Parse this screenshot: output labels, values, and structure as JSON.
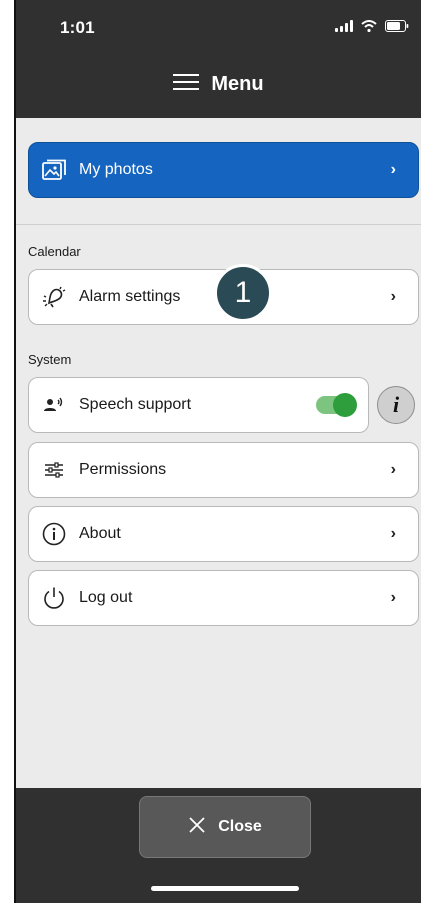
{
  "status": {
    "time": "1:01"
  },
  "header": {
    "title": "Menu",
    "menu_icon": "hamburger-icon"
  },
  "items": {
    "my_photos": {
      "label": "My photos",
      "icon": "photo-gallery-icon"
    },
    "alarm_settings": {
      "label": "Alarm settings",
      "icon": "bell-ringing-icon"
    },
    "speech_support": {
      "label": "Speech support",
      "icon": "speaking-person-icon",
      "enabled": true
    },
    "permissions": {
      "label": "Permissions",
      "icon": "sliders-icon"
    },
    "about": {
      "label": "About",
      "icon": "info-circle-icon"
    },
    "log_out": {
      "label": "Log out",
      "icon": "power-icon"
    }
  },
  "sections": {
    "calendar": "Calendar",
    "system": "System"
  },
  "badge": {
    "number": "1"
  },
  "footer": {
    "close_label": "Close"
  },
  "colors": {
    "primary": "#1565c0",
    "toggle_on": "#2e9e3c",
    "header_bg": "#303030",
    "badge_bg": "#2a4a55"
  }
}
